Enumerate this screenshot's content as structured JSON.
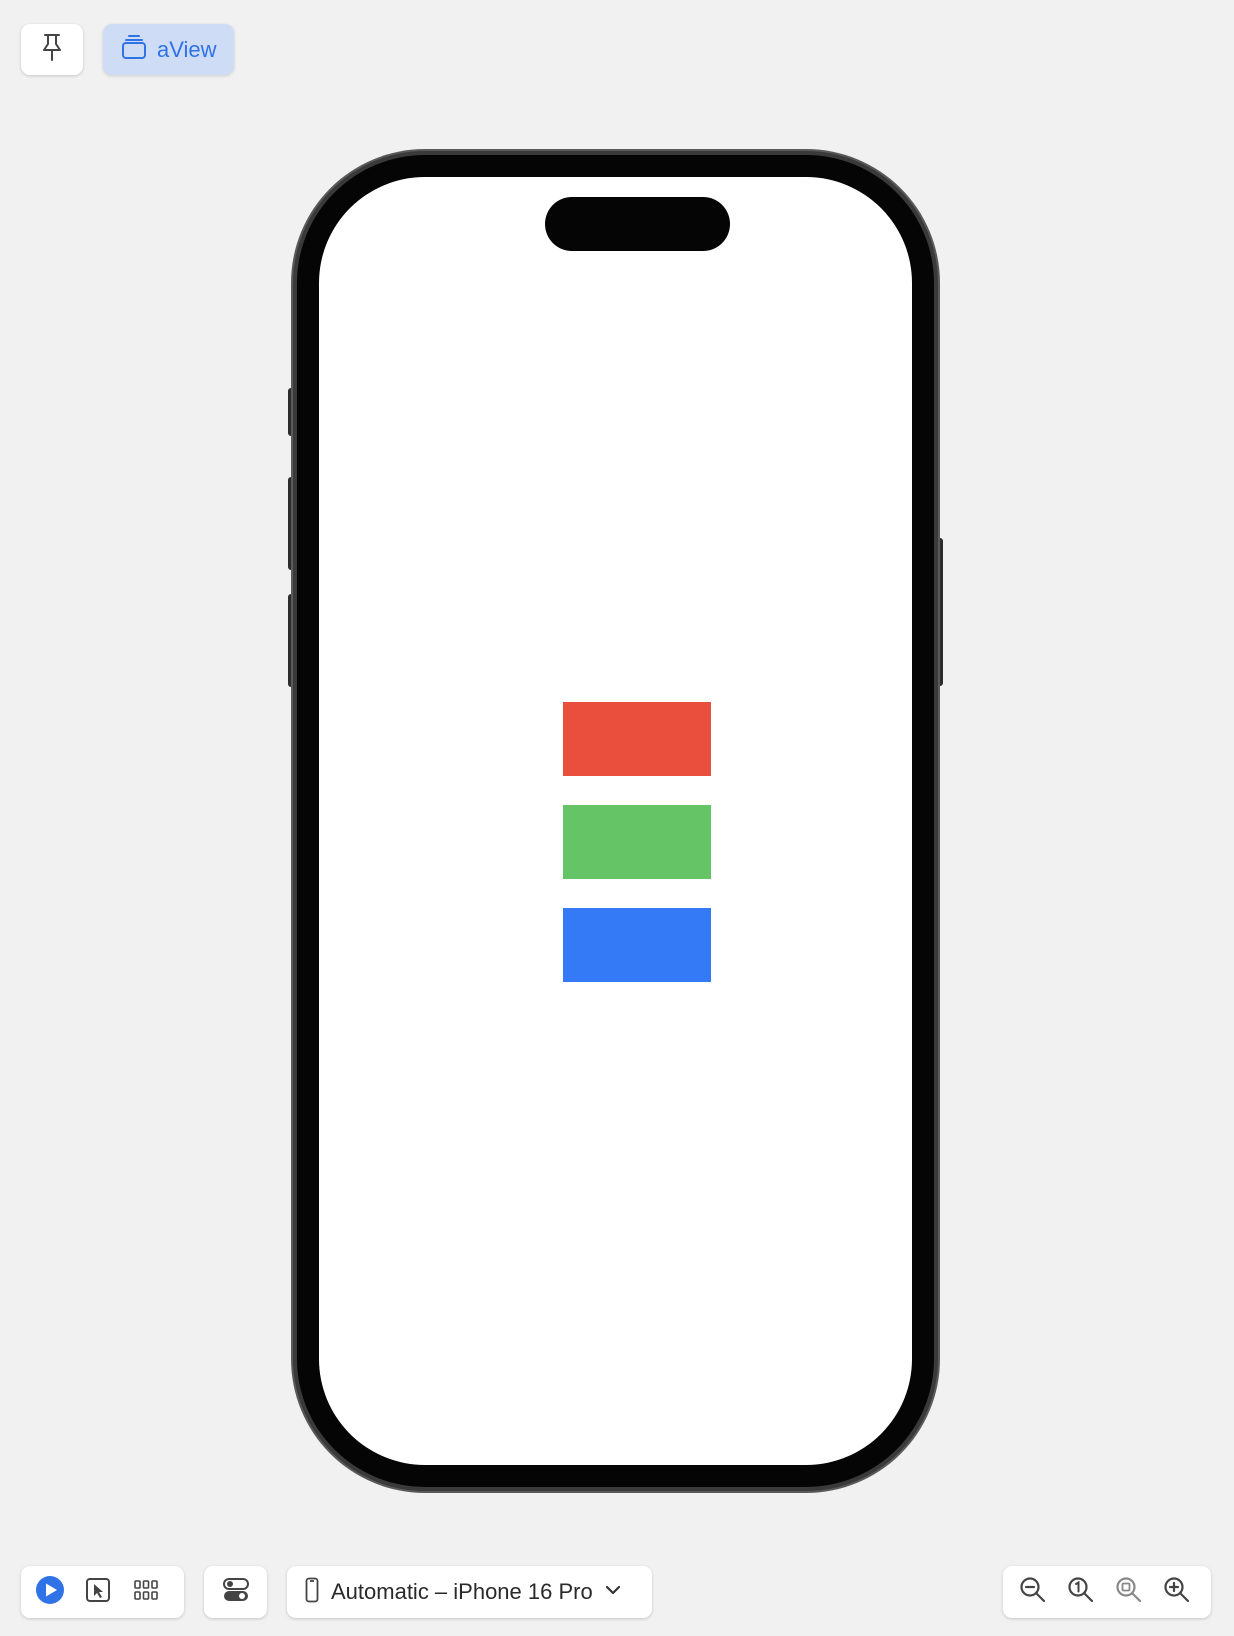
{
  "top_bar": {
    "pin_icon": "pin-icon",
    "view_chip": {
      "icon": "stack-icon",
      "label": "aView"
    }
  },
  "preview": {
    "device_frame": "iPhone 16 Pro",
    "colors": {
      "red": "#ea4f3d",
      "green": "#65c466",
      "blue": "#3479f6",
      "accent": "#2f73e6"
    },
    "rectangles": [
      "red",
      "green",
      "blue"
    ]
  },
  "bottom_bar": {
    "mode_tools": [
      "live-play-icon",
      "selectable-pointer-icon",
      "variants-grid-icon"
    ],
    "settings_icon": "device-settings-toggle-icon",
    "device_selector": {
      "icon": "iphone-icon",
      "label": "Automatic – iPhone 16 Pro",
      "chevron": "chevron-down-icon"
    },
    "zoom_tools": [
      "zoom-out-icon",
      "zoom-100-icon",
      "zoom-fit-icon",
      "zoom-in-icon"
    ]
  }
}
